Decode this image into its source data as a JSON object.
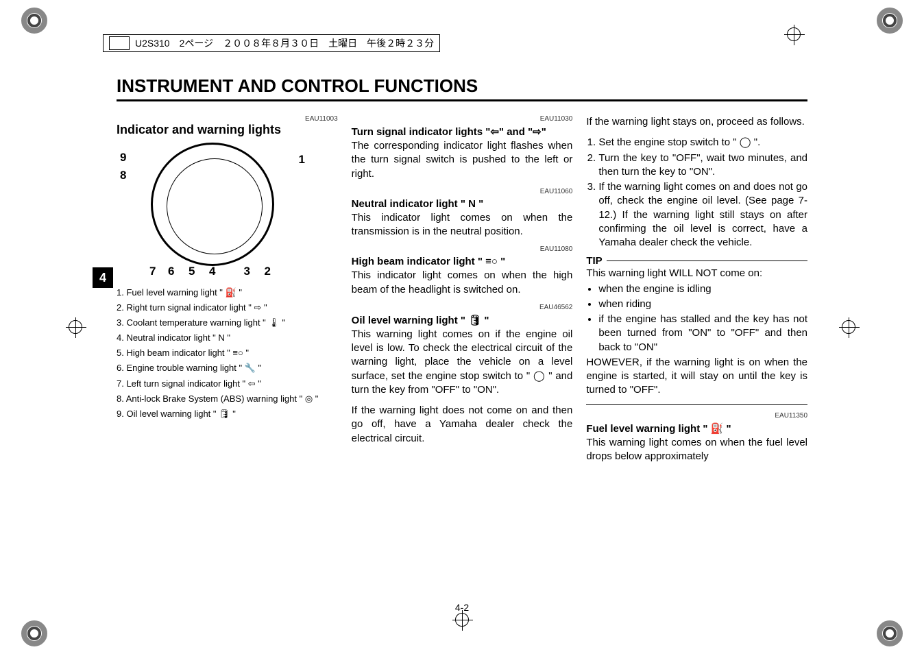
{
  "header": {
    "file_info": "U2S310　2ページ　２００８年８月３０日　土曜日　午後２時２３分"
  },
  "page_title": "INSTRUMENT AND CONTROL FUNCTIONS",
  "chapter_tab": "4",
  "page_number": "4-2",
  "col1": {
    "refcode": "EAU11003",
    "section_title": "Indicator and warning lights",
    "callouts": {
      "c1": "1",
      "c2": "2",
      "c3": "3",
      "c4": "4",
      "c5": "5",
      "c6": "6",
      "c7": "7",
      "c8": "8",
      "c9": "9"
    },
    "legend": [
      "1. Fuel level warning light \" ⛽ \"",
      "2. Right turn signal indicator light \" ⇨ \"",
      "3. Coolant temperature warning light \" 🌡 \"",
      "4. Neutral indicator light \" N \"",
      "5. High beam indicator light \" ≡○ \"",
      "6. Engine trouble warning light \" 🔧 \"",
      "7. Left turn signal indicator light \" ⇦ \"",
      "8. Anti-lock Brake System (ABS) warning light \" ◎ \"",
      "9. Oil level warning light \" 🛢 \""
    ]
  },
  "col2": {
    "s1": {
      "refcode": "EAU11030",
      "title": "Turn signal indicator lights \"⇦\" and \"⇨\"",
      "body": "The corresponding indicator light flashes when the turn signal switch is pushed to the left or right."
    },
    "s2": {
      "refcode": "EAU11060",
      "title": "Neutral indicator light \" N \"",
      "body": "This indicator light comes on when the transmission is in the neutral position."
    },
    "s3": {
      "refcode": "EAU11080",
      "title": "High beam indicator light \" ≡○ \"",
      "body": "This indicator light comes on when the high beam of the headlight is switched on."
    },
    "s4": {
      "refcode": "EAU46562",
      "title": "Oil level warning light \" 🛢 \"",
      "body1": "This warning light comes on if the engine oil level is low. To check the electrical circuit of the warning light, place the vehicle on a level surface, set the engine stop switch to \" ◯ \" and turn the key from \"OFF\" to \"ON\".",
      "body2": "If the warning light does not come on and then go off, have a Yamaha dealer check the electrical circuit."
    }
  },
  "col3": {
    "cont": "If the warning light stays on, proceed as follows.",
    "steps": [
      "Set the engine stop switch to \" ◯ \".",
      "Turn the key to \"OFF\", wait two minutes, and then turn the key to \"ON\".",
      "If the warning light comes on and does not go off, check the engine oil level. (See page 7-12.) If the warning light still stays on after confirming the oil level is correct, have a Yamaha dealer check the vehicle."
    ],
    "tip_label": "TIP",
    "tip_intro": "This warning light WILL NOT come on:",
    "tip_bullets": [
      "when the engine is idling",
      "when riding",
      "if the engine has stalled and the key has not been turned from \"ON\" to \"OFF\" and then back to \"ON\""
    ],
    "tip_however": "HOWEVER, if the warning light is on when the engine is started, it will stay on until the key is turned to \"OFF\".",
    "s5": {
      "refcode": "EAU11350",
      "title": "Fuel level warning light \" ⛽ \"",
      "body": "This warning light comes on when the fuel level drops below approximately"
    }
  }
}
